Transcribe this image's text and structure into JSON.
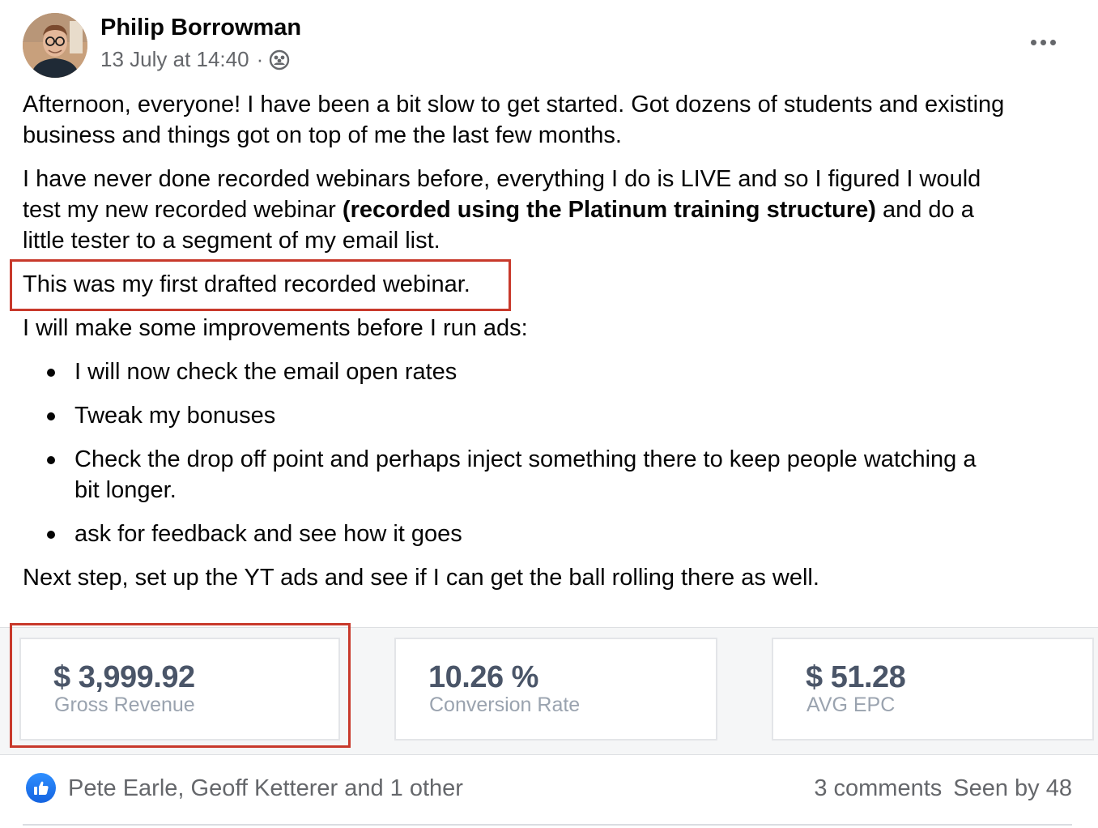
{
  "header": {
    "author_name": "Philip Borrowman",
    "timestamp": "13 July at 14:40",
    "separator": "·",
    "audience_icon": "group-icon",
    "more_icon": "more-options-icon"
  },
  "body": {
    "para1": "Afternoon, everyone! I have been a bit slow to get started. Got dozens of students and existing",
    "para1_line2": "business and things got on top of me the last few months.",
    "para2_line1": "I have never done recorded webinars before, everything I do is LIVE and so I figured I would",
    "para2_line2_pre": "test my new recorded webinar ",
    "para2_line2_bold": "(recorded using the Platinum training structure)",
    "para2_line2_post": " and do a",
    "para2_line3": "little tester to a segment of my email list.",
    "para3": "This was my first drafted recorded webinar.",
    "para4": "I will make some improvements before I run ads:",
    "bullets": [
      {
        "line1": "I will now check the email open rates"
      },
      {
        "line1": "Tweak my bonuses"
      },
      {
        "line1": "Check the drop off point and perhaps inject something there to keep people watching a",
        "line2": "bit longer."
      },
      {
        "line1": "ask for feedback and see how it goes"
      }
    ],
    "para5": "Next step, set up the YT ads and see if I can get the ball rolling there as well."
  },
  "stats": [
    {
      "value": "$ 3,999.92",
      "label": "Gross Revenue"
    },
    {
      "value": "10.26 %",
      "label": "Conversion Rate"
    },
    {
      "value": "$ 51.28",
      "label": "AVG EPC"
    }
  ],
  "footer": {
    "like_icon": "thumbs-up-icon",
    "reactors": "Pete Earle, Geoff Ketterer and 1 other",
    "comments": "3 comments",
    "seen_by": "Seen by 48"
  },
  "colors": {
    "highlight_box": "#c8392b",
    "like_blue": "#1877f2",
    "secondary_text": "#65676b"
  }
}
